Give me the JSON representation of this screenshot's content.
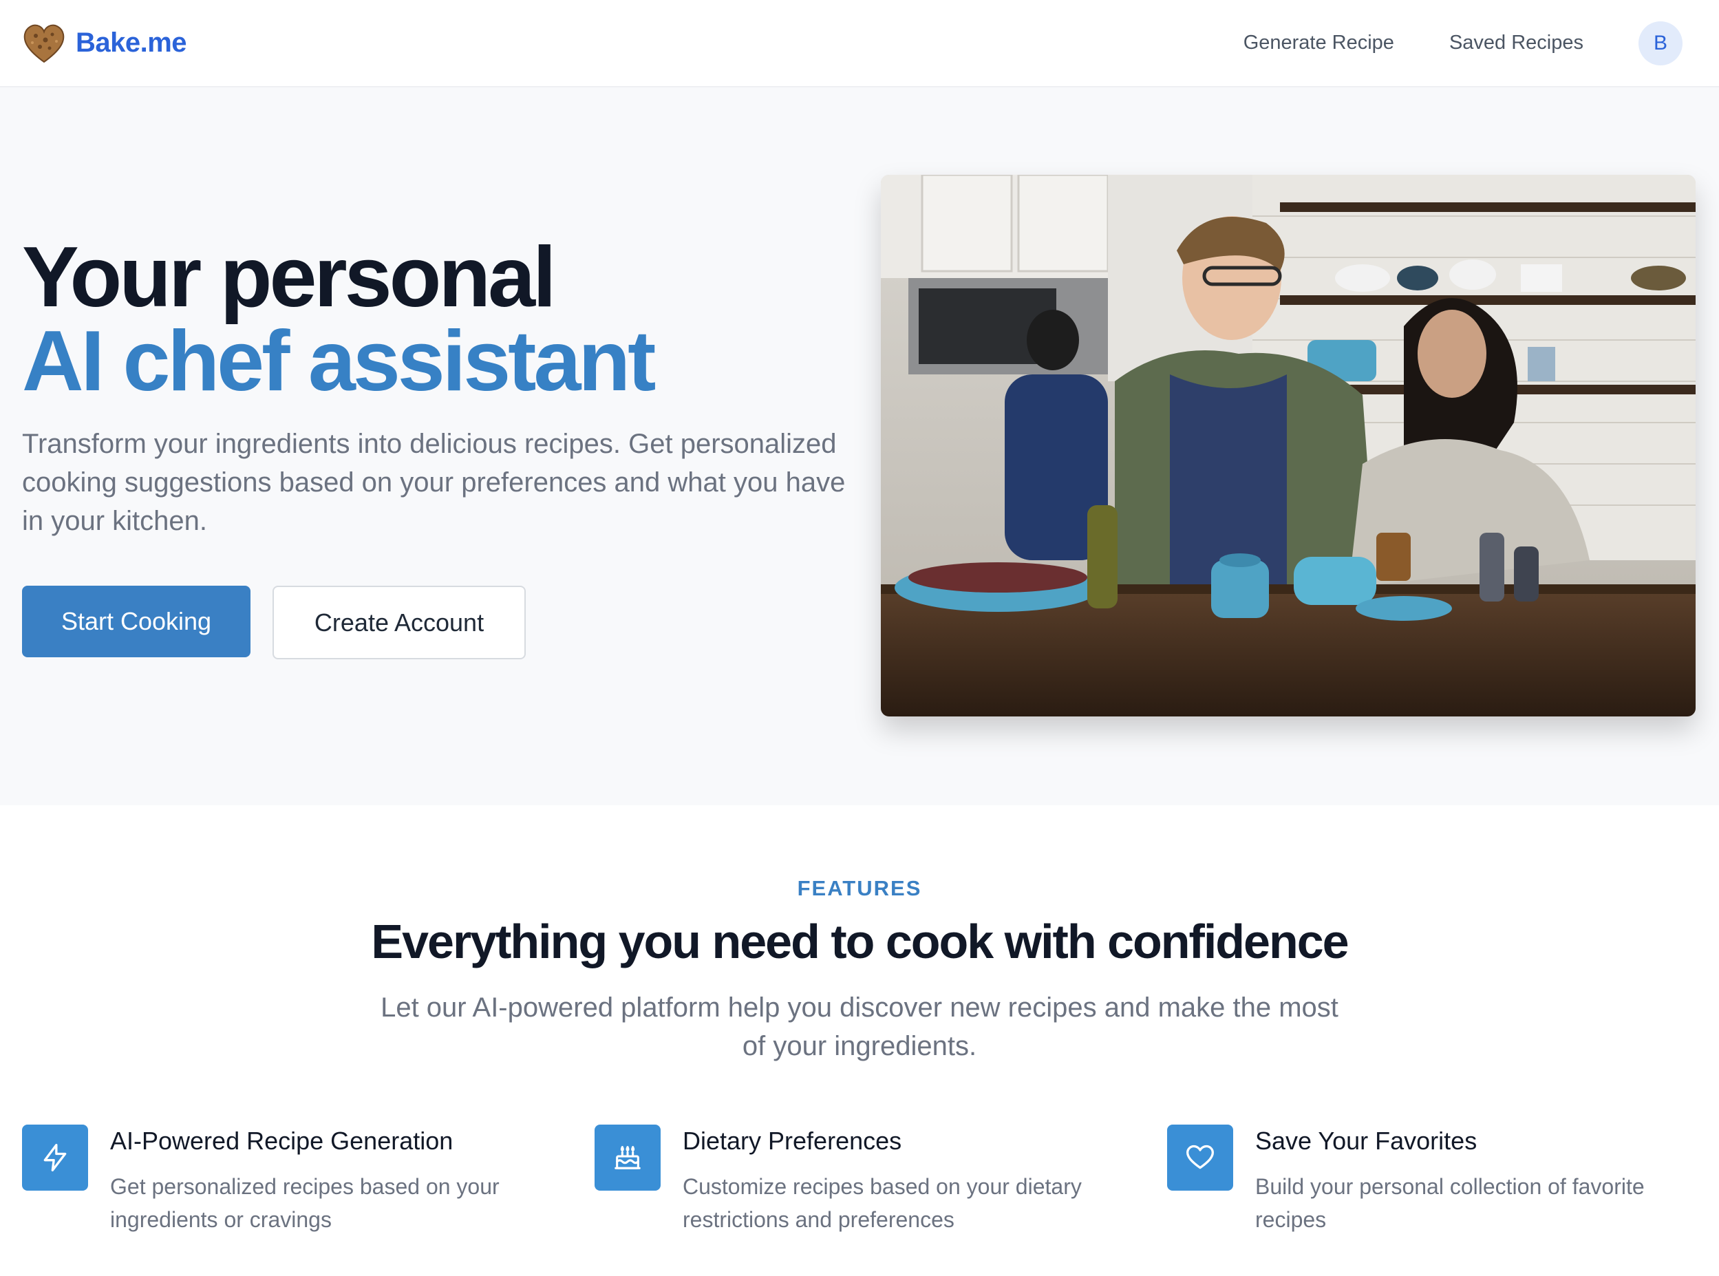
{
  "nav": {
    "brand": "Bake.me",
    "links": [
      "Generate Recipe",
      "Saved Recipes"
    ],
    "avatar_initial": "B"
  },
  "hero": {
    "title_line1": "Your personal",
    "title_line2": "AI chef assistant",
    "description": "Transform your ingredients into delicious recipes. Get personalized cooking suggestions based on your preferences and what you have in your kitchen.",
    "primary_button": "Start Cooking",
    "secondary_button": "Create Account"
  },
  "features": {
    "eyebrow": "FEATURES",
    "title": "Everything you need to cook with confidence",
    "subtitle": "Let our AI-powered platform help you discover new recipes and make the most of your ingredients.",
    "items": [
      {
        "icon": "lightning-icon",
        "title": "AI-Powered Recipe Generation",
        "description": "Get personalized recipes based on your ingredients or cravings"
      },
      {
        "icon": "cake-icon",
        "title": "Dietary Preferences",
        "description": "Customize recipes based on your dietary restrictions and preferences"
      },
      {
        "icon": "heart-icon",
        "title": "Save Your Favorites",
        "description": "Build your personal collection of favorite recipes"
      }
    ]
  },
  "colors": {
    "brand": "#2b63d9",
    "accent": "#3a80c4",
    "icon_bg": "#3a8fd6",
    "hero_bg": "#f8f9fb"
  }
}
